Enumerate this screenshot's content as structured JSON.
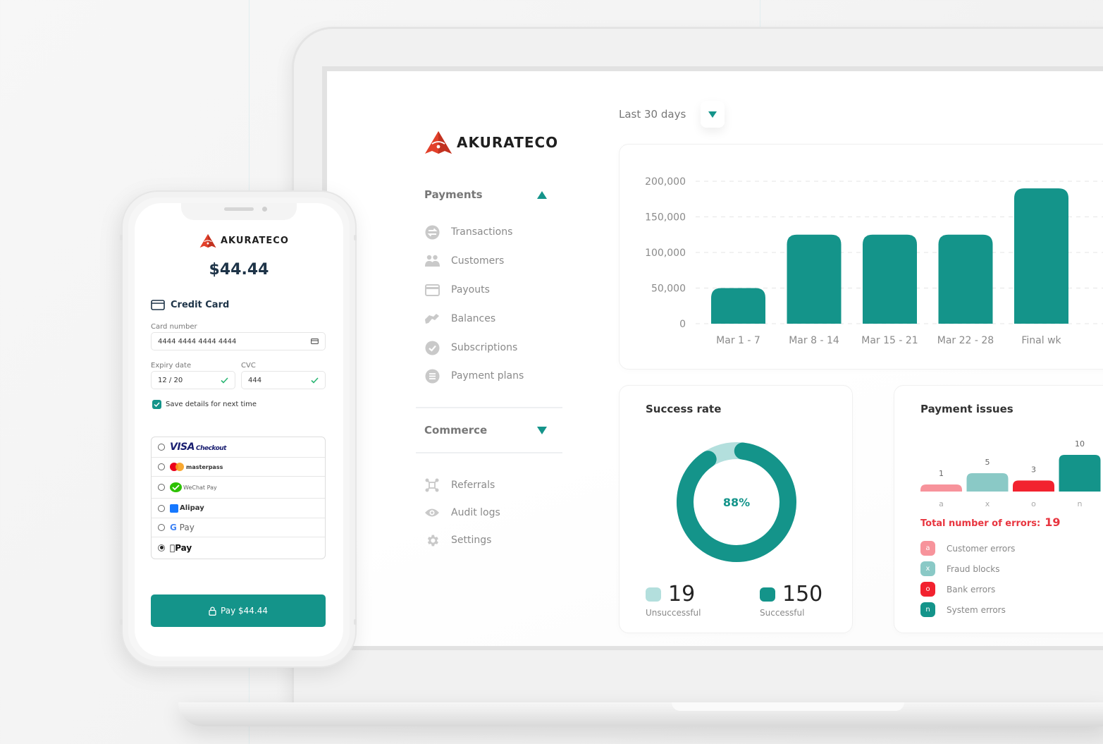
{
  "brand": {
    "name": "AKURATECO",
    "logo_icon": "akurateco-triangle-logo",
    "accent_color": "#14948a",
    "logo_color": "#e2402a"
  },
  "dashboard": {
    "sidebar": {
      "sections": [
        {
          "label": "Payments",
          "expanded": true,
          "toggle_icon": "triangle-up-icon",
          "items": [
            {
              "label": "Transactions",
              "icon": "transfer-icon"
            },
            {
              "label": "Customers",
              "icon": "users-icon"
            },
            {
              "label": "Payouts",
              "icon": "card-icon"
            },
            {
              "label": "Balances",
              "icon": "handshake-icon"
            },
            {
              "label": "Subscriptions",
              "icon": "check-circle-icon"
            },
            {
              "label": "Payment plans",
              "icon": "list-circle-icon"
            }
          ]
        },
        {
          "label": "Commerce",
          "expanded": false,
          "toggle_icon": "triangle-down-icon",
          "items": []
        }
      ],
      "footer_items": [
        {
          "label": "Referrals",
          "icon": "network-icon"
        },
        {
          "label": "Audit logs",
          "icon": "eye-icon"
        },
        {
          "label": "Settings",
          "icon": "gear-icon"
        }
      ]
    },
    "date_range": {
      "selected": "Last 30 days",
      "dropdown_icon": "triangle-down-icon"
    },
    "success_rate": {
      "title": "Success rate",
      "percent_label": "88%",
      "unsuccessful": {
        "value": "19",
        "label": "Unsuccessful",
        "color": "#b3dfdd"
      },
      "successful": {
        "value": "150",
        "label": "Successful",
        "color": "#14948a"
      }
    },
    "payment_issues": {
      "title": "Payment issues",
      "total_label": "Total number of errors:",
      "total_value": "19",
      "legend": [
        {
          "key": "a",
          "label": "Customer errors",
          "color": "#f7939b"
        },
        {
          "key": "x",
          "label": "Fraud blocks",
          "color": "#8ac9c6"
        },
        {
          "key": "o",
          "label": "Bank errors",
          "color": "#f2222f"
        },
        {
          "key": "n",
          "label": "System errors",
          "color": "#14948a"
        }
      ]
    }
  },
  "chart_data": [
    {
      "type": "bar",
      "title": "",
      "categories": [
        "Mar 1 - 7",
        "Mar 8 - 14",
        "Mar 15 - 21",
        "Mar 22 - 28",
        "Final wk"
      ],
      "values": [
        50000,
        125000,
        125000,
        125000,
        190000
      ],
      "yticks": [
        "0",
        "50,000",
        "100,000",
        "150,000",
        "200,000"
      ],
      "ylim": [
        0,
        200000
      ],
      "grid": true,
      "xlabel": "",
      "ylabel": "",
      "color": "#14948a"
    },
    {
      "type": "pie",
      "title": "Success rate",
      "categories": [
        "Unsuccessful",
        "Successful"
      ],
      "values": [
        19,
        150
      ],
      "center_label": "88%",
      "colors": [
        "#b3dfdd",
        "#14948a"
      ]
    },
    {
      "type": "bar",
      "title": "Payment issues",
      "categories": [
        "a",
        "x",
        "o",
        "n"
      ],
      "values": [
        1,
        5,
        3,
        10
      ],
      "data_labels": [
        "1",
        "5",
        "3",
        "10"
      ],
      "colors": [
        "#f7939b",
        "#8ac9c6",
        "#f2222f",
        "#14948a"
      ],
      "ylim": [
        0,
        10
      ]
    }
  ],
  "phone": {
    "amount": "$44.44",
    "payment_type": {
      "label": "Credit Card",
      "icon": "credit-card-icon"
    },
    "card_number": {
      "label": "Card number",
      "value": "4444 4444 4444 4444",
      "icon": "card-icon"
    },
    "expiry": {
      "label": "Expiry date",
      "value": "12 / 20",
      "valid_icon": "check-icon"
    },
    "cvc": {
      "label": "CVC",
      "value": "444",
      "valid_icon": "check-icon"
    },
    "save_details": {
      "label": "Save details for next time",
      "checked": true
    },
    "methods": [
      {
        "label": "VISA Checkout",
        "selected": false,
        "icon": "visa-checkout-logo"
      },
      {
        "label": "masterpass",
        "selected": false,
        "icon": "masterpass-logo"
      },
      {
        "label": "WeChat Pay",
        "selected": false,
        "icon": "wechat-pay-logo"
      },
      {
        "label": "Alipay",
        "selected": false,
        "icon": "alipay-logo"
      },
      {
        "label": "G Pay",
        "selected": false,
        "icon": "google-pay-logo"
      },
      {
        "label": "Pay",
        "selected": true,
        "icon": "apple-pay-logo"
      }
    ],
    "pay_button": {
      "label": "Pay $44.44",
      "icon": "lock-icon"
    }
  }
}
